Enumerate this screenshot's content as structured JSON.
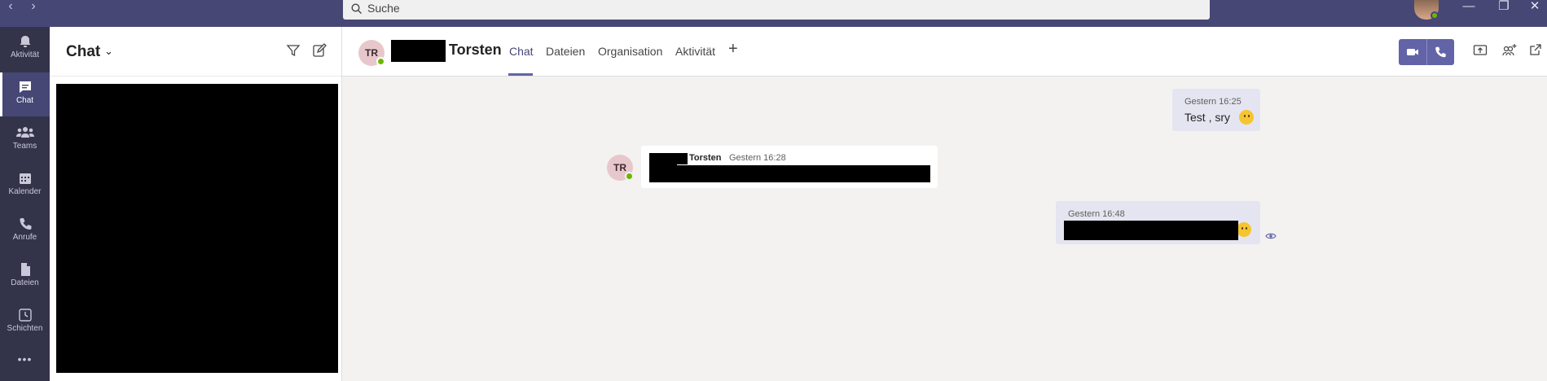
{
  "titlebar": {
    "back_icon": "‹",
    "forward_icon": "›",
    "search_placeholder": "Suche",
    "minimize_icon": "—",
    "restore_icon": "❐",
    "close_icon": "✕"
  },
  "rail": {
    "items": [
      {
        "label": "Aktivität",
        "icon": "bell-icon"
      },
      {
        "label": "Chat",
        "icon": "chat-icon"
      },
      {
        "label": "Teams",
        "icon": "teams-icon"
      },
      {
        "label": "Kalender",
        "icon": "calendar-icon"
      },
      {
        "label": "Anrufe",
        "icon": "phone-icon"
      },
      {
        "label": "Dateien",
        "icon": "file-icon"
      },
      {
        "label": "Schichten",
        "icon": "clock-icon"
      }
    ],
    "more": "•••"
  },
  "list": {
    "title": "Chat",
    "chevron": "⌄"
  },
  "header": {
    "initials": "TR",
    "name": "Torsten",
    "tabs": [
      "Chat",
      "Dateien",
      "Organisation",
      "Aktivität"
    ],
    "add": "+"
  },
  "messages": {
    "m1": {
      "time": "Gestern 16:25",
      "text": "Test , sry"
    },
    "m2": {
      "initials": "TR",
      "sender": "Torsten",
      "time": "Gestern 16:28"
    },
    "m3": {
      "time": "Gestern 16:48"
    }
  },
  "colors": {
    "accent": "#6264a7",
    "titlebar": "#464775",
    "rail": "#33344a",
    "presence": "#6bb700"
  }
}
